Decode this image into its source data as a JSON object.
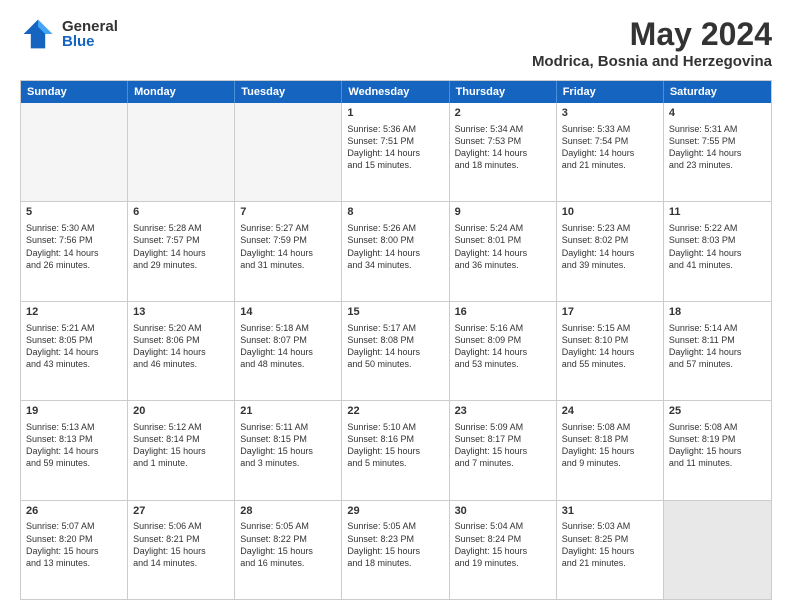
{
  "logo": {
    "general": "General",
    "blue": "Blue"
  },
  "header": {
    "month": "May 2024",
    "location": "Modrica, Bosnia and Herzegovina"
  },
  "weekdays": [
    "Sunday",
    "Monday",
    "Tuesday",
    "Wednesday",
    "Thursday",
    "Friday",
    "Saturday"
  ],
  "weeks": [
    [
      {
        "day": "",
        "empty": true
      },
      {
        "day": "",
        "empty": true
      },
      {
        "day": "",
        "empty": true
      },
      {
        "day": "1",
        "info": "Sunrise: 5:36 AM\nSunset: 7:51 PM\nDaylight: 14 hours\nand 15 minutes."
      },
      {
        "day": "2",
        "info": "Sunrise: 5:34 AM\nSunset: 7:53 PM\nDaylight: 14 hours\nand 18 minutes."
      },
      {
        "day": "3",
        "info": "Sunrise: 5:33 AM\nSunset: 7:54 PM\nDaylight: 14 hours\nand 21 minutes."
      },
      {
        "day": "4",
        "info": "Sunrise: 5:31 AM\nSunset: 7:55 PM\nDaylight: 14 hours\nand 23 minutes."
      }
    ],
    [
      {
        "day": "5",
        "info": "Sunrise: 5:30 AM\nSunset: 7:56 PM\nDaylight: 14 hours\nand 26 minutes."
      },
      {
        "day": "6",
        "info": "Sunrise: 5:28 AM\nSunset: 7:57 PM\nDaylight: 14 hours\nand 29 minutes."
      },
      {
        "day": "7",
        "info": "Sunrise: 5:27 AM\nSunset: 7:59 PM\nDaylight: 14 hours\nand 31 minutes."
      },
      {
        "day": "8",
        "info": "Sunrise: 5:26 AM\nSunset: 8:00 PM\nDaylight: 14 hours\nand 34 minutes."
      },
      {
        "day": "9",
        "info": "Sunrise: 5:24 AM\nSunset: 8:01 PM\nDaylight: 14 hours\nand 36 minutes."
      },
      {
        "day": "10",
        "info": "Sunrise: 5:23 AM\nSunset: 8:02 PM\nDaylight: 14 hours\nand 39 minutes."
      },
      {
        "day": "11",
        "info": "Sunrise: 5:22 AM\nSunset: 8:03 PM\nDaylight: 14 hours\nand 41 minutes."
      }
    ],
    [
      {
        "day": "12",
        "info": "Sunrise: 5:21 AM\nSunset: 8:05 PM\nDaylight: 14 hours\nand 43 minutes."
      },
      {
        "day": "13",
        "info": "Sunrise: 5:20 AM\nSunset: 8:06 PM\nDaylight: 14 hours\nand 46 minutes."
      },
      {
        "day": "14",
        "info": "Sunrise: 5:18 AM\nSunset: 8:07 PM\nDaylight: 14 hours\nand 48 minutes."
      },
      {
        "day": "15",
        "info": "Sunrise: 5:17 AM\nSunset: 8:08 PM\nDaylight: 14 hours\nand 50 minutes."
      },
      {
        "day": "16",
        "info": "Sunrise: 5:16 AM\nSunset: 8:09 PM\nDaylight: 14 hours\nand 53 minutes."
      },
      {
        "day": "17",
        "info": "Sunrise: 5:15 AM\nSunset: 8:10 PM\nDaylight: 14 hours\nand 55 minutes."
      },
      {
        "day": "18",
        "info": "Sunrise: 5:14 AM\nSunset: 8:11 PM\nDaylight: 14 hours\nand 57 minutes."
      }
    ],
    [
      {
        "day": "19",
        "info": "Sunrise: 5:13 AM\nSunset: 8:13 PM\nDaylight: 14 hours\nand 59 minutes."
      },
      {
        "day": "20",
        "info": "Sunrise: 5:12 AM\nSunset: 8:14 PM\nDaylight: 15 hours\nand 1 minute."
      },
      {
        "day": "21",
        "info": "Sunrise: 5:11 AM\nSunset: 8:15 PM\nDaylight: 15 hours\nand 3 minutes."
      },
      {
        "day": "22",
        "info": "Sunrise: 5:10 AM\nSunset: 8:16 PM\nDaylight: 15 hours\nand 5 minutes."
      },
      {
        "day": "23",
        "info": "Sunrise: 5:09 AM\nSunset: 8:17 PM\nDaylight: 15 hours\nand 7 minutes."
      },
      {
        "day": "24",
        "info": "Sunrise: 5:08 AM\nSunset: 8:18 PM\nDaylight: 15 hours\nand 9 minutes."
      },
      {
        "day": "25",
        "info": "Sunrise: 5:08 AM\nSunset: 8:19 PM\nDaylight: 15 hours\nand 11 minutes."
      }
    ],
    [
      {
        "day": "26",
        "info": "Sunrise: 5:07 AM\nSunset: 8:20 PM\nDaylight: 15 hours\nand 13 minutes."
      },
      {
        "day": "27",
        "info": "Sunrise: 5:06 AM\nSunset: 8:21 PM\nDaylight: 15 hours\nand 14 minutes."
      },
      {
        "day": "28",
        "info": "Sunrise: 5:05 AM\nSunset: 8:22 PM\nDaylight: 15 hours\nand 16 minutes."
      },
      {
        "day": "29",
        "info": "Sunrise: 5:05 AM\nSunset: 8:23 PM\nDaylight: 15 hours\nand 18 minutes."
      },
      {
        "day": "30",
        "info": "Sunrise: 5:04 AM\nSunset: 8:24 PM\nDaylight: 15 hours\nand 19 minutes."
      },
      {
        "day": "31",
        "info": "Sunrise: 5:03 AM\nSunset: 8:25 PM\nDaylight: 15 hours\nand 21 minutes."
      },
      {
        "day": "",
        "empty": true,
        "shaded": true
      }
    ]
  ]
}
